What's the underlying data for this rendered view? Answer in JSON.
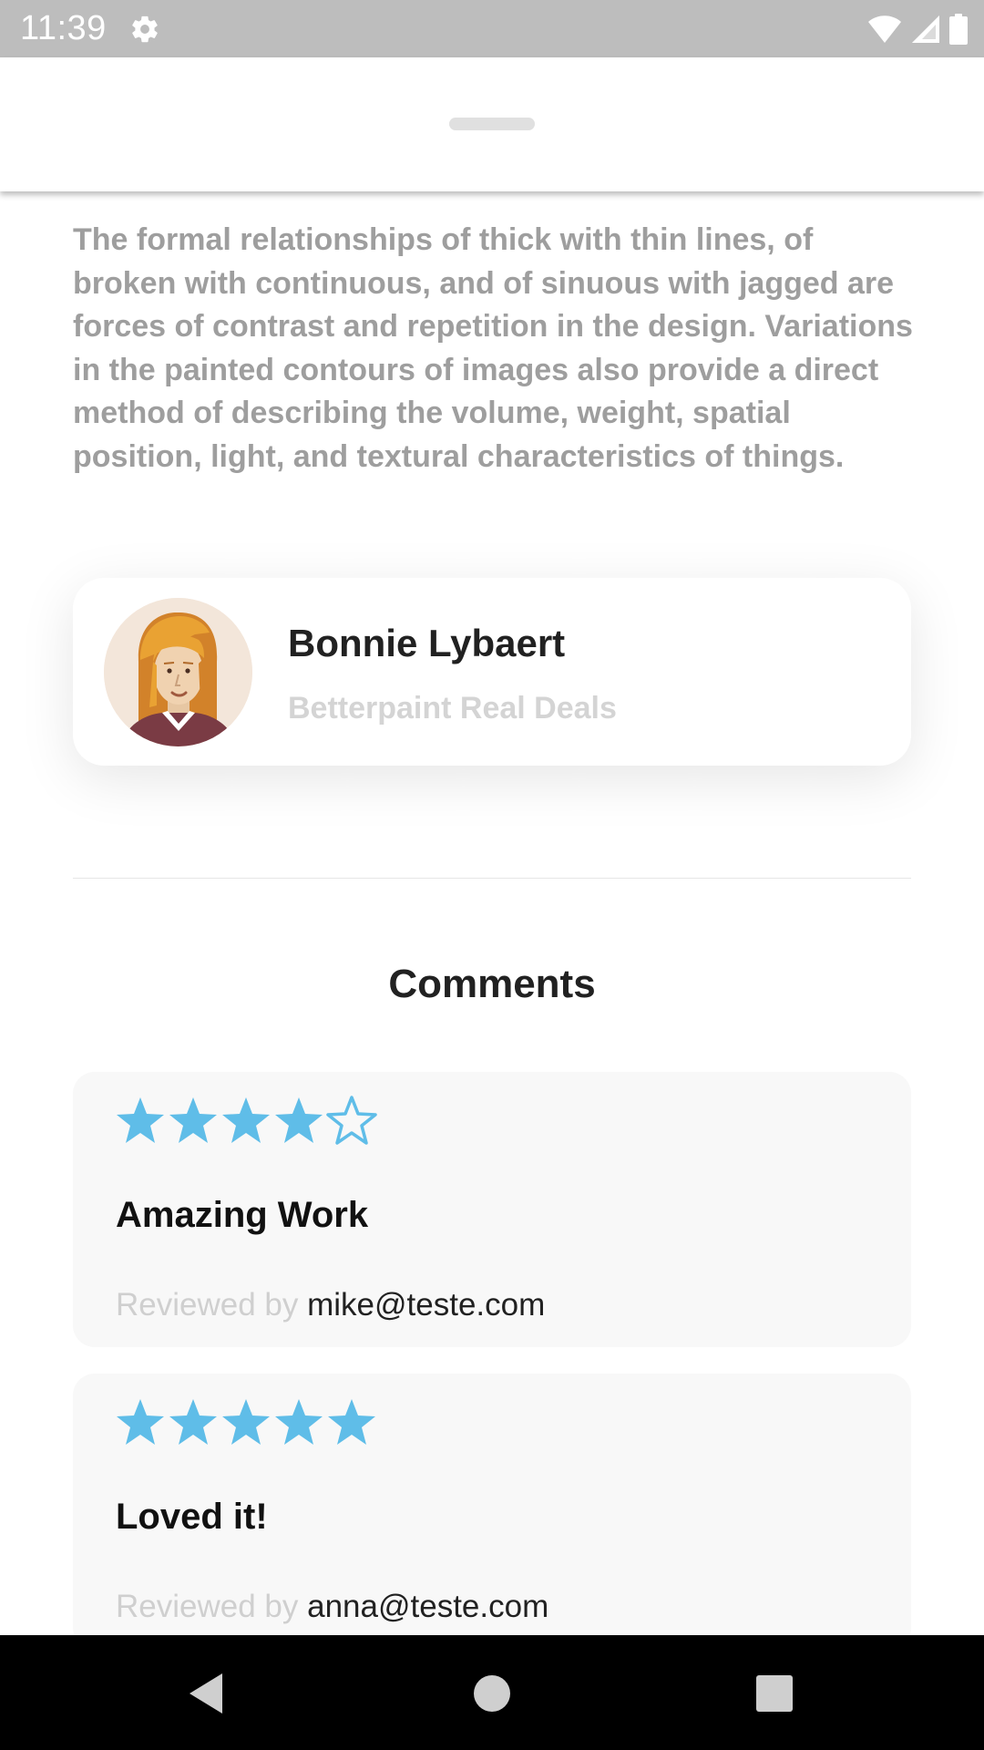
{
  "status_bar": {
    "time": "11:39",
    "icons": [
      "settings-icon",
      "wifi-icon",
      "signal-icon",
      "battery-icon"
    ],
    "background": "#bdbdbd"
  },
  "sheet": {
    "description": "The formal relationships of thick with thin lines, of broken with continuous, and of sinuous with jagged are forces of contrast and repetition in the design. Variations in the painted contours of images also provide a direct method of describing the volume, weight, spatial position, light, and textural characteristics of things."
  },
  "profile": {
    "name": "Bonnie Lybaert",
    "company": "Betterpaint Real Deals",
    "avatar_icon": "female-avatar-icon"
  },
  "comments": {
    "title": "Comments",
    "star_color": "#5fbde8",
    "items": [
      {
        "rating": 4,
        "max_rating": 5,
        "title": "Amazing Work",
        "reviewed_label": "Reviewed by",
        "reviewer": "mike@teste.com"
      },
      {
        "rating": 5,
        "max_rating": 5,
        "title": "Loved it!",
        "reviewed_label": "Reviewed by",
        "reviewer": "anna@teste.com"
      }
    ]
  },
  "nav_bar": {
    "buttons": [
      "back-icon",
      "home-icon",
      "recents-icon"
    ]
  }
}
